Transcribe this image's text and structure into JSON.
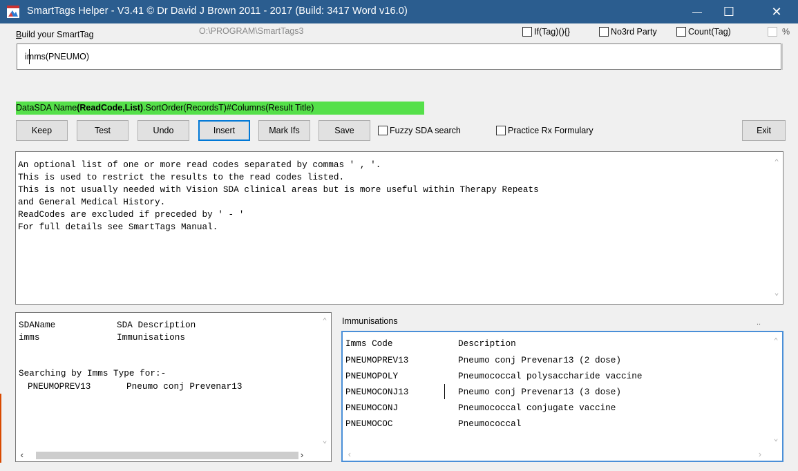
{
  "window": {
    "title": "SmartTags  Helper - V3.41 © Dr David J Brown 2011 - 2017 (Build: 3417 Word v16.0)",
    "controls": {
      "minimize": "—",
      "maximize": "☐",
      "close": "✕"
    }
  },
  "build": {
    "label_prefix": "B",
    "label_rest": "uild your SmartTag",
    "path": "O:\\PROGRAM\\SmartTags3",
    "tag_value": "imms(PNEUMO)"
  },
  "options": {
    "if_tag": "If(Tag)(){}",
    "no3rd": "No3rd Party",
    "count": "Count(Tag)",
    "percent": "%",
    "fuzzy": "Fuzzy SDA search",
    "practice_rx": "Practice Rx Formulary"
  },
  "syntax_hint": {
    "before": "DataSDA Name",
    "bold": "(ReadCode,List)",
    "after": ".SortOrder(RecordsT)#Columns(Result Title)"
  },
  "buttons": {
    "keep": "Keep",
    "test": "Test",
    "undo": "Undo",
    "insert": "Insert",
    "mark_ifs": "Mark Ifs",
    "save": "Save",
    "exit": "Exit"
  },
  "description": [
    "An optional list of one or more read codes separated by commas ' , '.",
    "This is used to restrict the results to the read codes listed.",
    "This is not usually needed with Vision SDA clinical areas but is more useful within Therapy Repeats",
    "and General Medical History.",
    "ReadCodes are excluded if preceded by ' - '",
    "For full details see SmartTags Manual."
  ],
  "sda_list": {
    "header": {
      "name": "SDAName",
      "description": "SDA Description"
    },
    "row": {
      "name": "imms",
      "description": "Immunisations"
    },
    "search_label": "Searching by Imms Type for:-",
    "search_code": "PNEUMOPREV13",
    "search_desc": "Pneumo conj Prevenar13"
  },
  "immunisations": {
    "label": "Immunisations",
    "dots": "..",
    "columns": {
      "code": "Imms Code",
      "description": "Description"
    },
    "rows": [
      {
        "code": "PNEUMOPREV13",
        "description": "Pneumo conj Prevenar13 (2 dose)"
      },
      {
        "code": "PNEUMOPOLY",
        "description": "Pneumococcal polysaccharide vaccine"
      },
      {
        "code": "PNEUMOCONJ13",
        "description": "Pneumo conj Prevenar13 (3 dose)"
      },
      {
        "code": "PNEUMOCONJ",
        "description": "Pneumococcal conjugate vaccine"
      },
      {
        "code": "PNEUMOCOC",
        "description": "Pneumococcal"
      }
    ]
  },
  "colors": {
    "titlebar": "#2b5d8f",
    "hint_background": "#55e04a",
    "focus_border": "#0078d7"
  }
}
